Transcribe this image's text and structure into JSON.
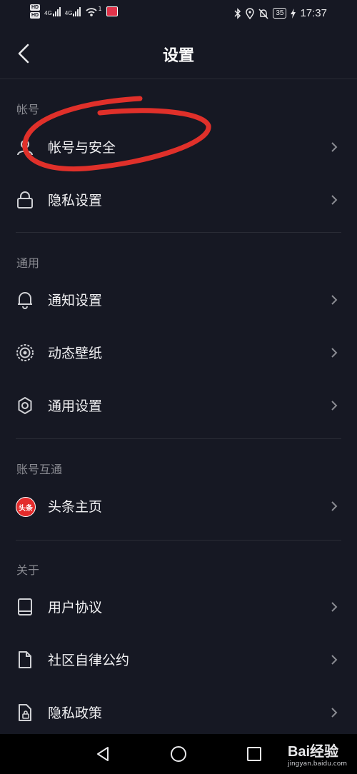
{
  "status_bar": {
    "hd1": "HD",
    "hd2": "HD",
    "net1": "4G",
    "net2": "4G",
    "wifi_badge": "1",
    "battery": "35",
    "time": "17:37"
  },
  "header": {
    "title": "设置"
  },
  "sections": {
    "account": {
      "label": "帐号",
      "items": [
        {
          "label": "帐号与安全",
          "icon": "user-icon"
        },
        {
          "label": "隐私设置",
          "icon": "lock-icon"
        }
      ]
    },
    "general": {
      "label": "通用",
      "items": [
        {
          "label": "通知设置",
          "icon": "bell-icon"
        },
        {
          "label": "动态壁纸",
          "icon": "wallpaper-icon"
        },
        {
          "label": "通用设置",
          "icon": "gear-icon"
        }
      ]
    },
    "linked": {
      "label": "账号互通",
      "items": [
        {
          "label": "头条主页",
          "icon": "toutiao-logo",
          "logo_text": "头条"
        }
      ]
    },
    "about": {
      "label": "关于",
      "items": [
        {
          "label": "用户协议",
          "icon": "book-icon"
        },
        {
          "label": "社区自律公约",
          "icon": "document-icon"
        },
        {
          "label": "隐私政策",
          "icon": "privacy-doc-icon"
        }
      ]
    }
  },
  "watermark": {
    "main": "Bai经验",
    "sub": "jingyan.baidu.com"
  },
  "colors": {
    "background": "#161823",
    "annotation": "#e0302a",
    "divider": "#2a2c36"
  }
}
